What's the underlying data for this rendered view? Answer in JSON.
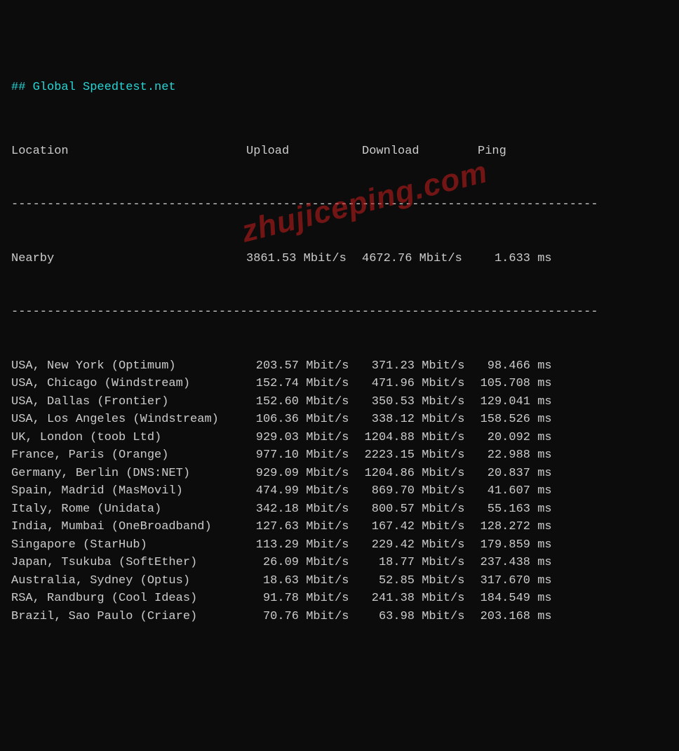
{
  "title": "## Global Speedtest.net",
  "headers": {
    "location": "Location",
    "upload": "Upload",
    "download": "Download",
    "ping": "Ping"
  },
  "unit_speed": "Mbit/s",
  "unit_ping": "ms",
  "divider": "----------------------------------------------------------------------------------",
  "nearby": {
    "location": "Nearby",
    "upload": "3861.53",
    "download": "4672.76",
    "ping": "1.633"
  },
  "rows": [
    {
      "location": "USA, New York (Optimum)",
      "upload": "203.57",
      "download": "371.23",
      "ping": "98.466"
    },
    {
      "location": "USA, Chicago (Windstream)",
      "upload": "152.74",
      "download": "471.96",
      "ping": "105.708"
    },
    {
      "location": "USA, Dallas (Frontier)",
      "upload": "152.60",
      "download": "350.53",
      "ping": "129.041"
    },
    {
      "location": "USA, Los Angeles (Windstream)",
      "upload": "106.36",
      "download": "338.12",
      "ping": "158.526"
    },
    {
      "location": "UK, London (toob Ltd)",
      "upload": "929.03",
      "download": "1204.88",
      "ping": "20.092"
    },
    {
      "location": "France, Paris (Orange)",
      "upload": "977.10",
      "download": "2223.15",
      "ping": "22.988"
    },
    {
      "location": "Germany, Berlin (DNS:NET)",
      "upload": "929.09",
      "download": "1204.86",
      "ping": "20.837"
    },
    {
      "location": "Spain, Madrid (MasMovil)",
      "upload": "474.99",
      "download": "869.70",
      "ping": "41.607"
    },
    {
      "location": "Italy, Rome (Unidata)",
      "upload": "342.18",
      "download": "800.57",
      "ping": "55.163"
    },
    {
      "location": "India, Mumbai (OneBroadband)",
      "upload": "127.63",
      "download": "167.42",
      "ping": "128.272"
    },
    {
      "location": "Singapore (StarHub)",
      "upload": "113.29",
      "download": "229.42",
      "ping": "179.859"
    },
    {
      "location": "Japan, Tsukuba (SoftEther)",
      "upload": "26.09",
      "download": "18.77",
      "ping": "237.438"
    },
    {
      "location": "Australia, Sydney (Optus)",
      "upload": "18.63",
      "download": "52.85",
      "ping": "317.670"
    },
    {
      "location": "RSA, Randburg (Cool Ideas)",
      "upload": "91.78",
      "download": "241.38",
      "ping": "184.549"
    },
    {
      "location": "Brazil, Sao Paulo (Criare)",
      "upload": "70.76",
      "download": "63.98",
      "ping": "203.168"
    }
  ],
  "watermark": "zhujiceping.com"
}
